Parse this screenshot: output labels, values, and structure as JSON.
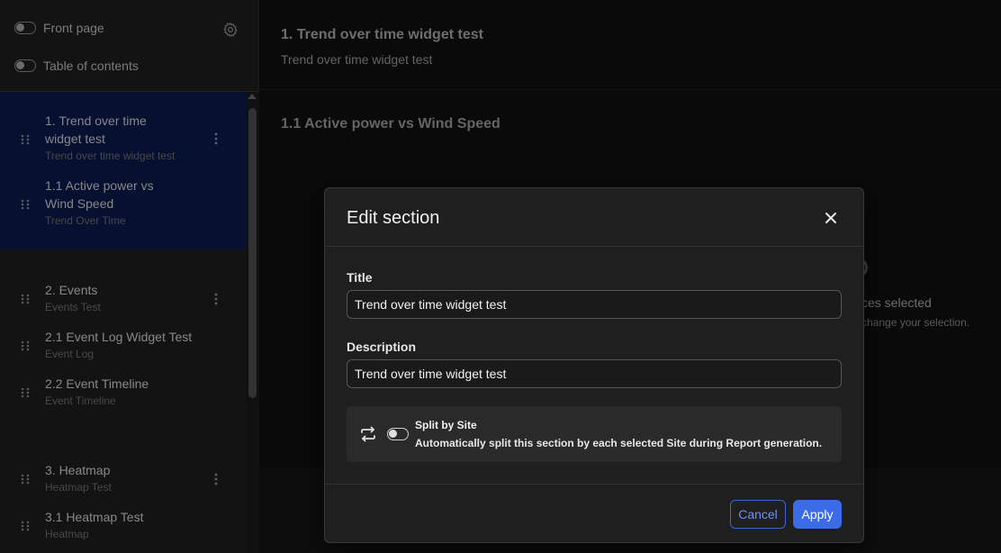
{
  "sidebar": {
    "toggles": [
      {
        "label": "Front page"
      },
      {
        "label": "Table of contents"
      }
    ],
    "items": [
      {
        "title_line1": "1. Trend over time",
        "title_line2": "widget test",
        "subtitle": "Trend over time widget test",
        "has_menu": true
      },
      {
        "title_line1": "1.1 Active power vs",
        "title_line2": "Wind Speed",
        "subtitle": "Trend Over Time",
        "has_menu": false
      },
      {
        "title_line1": "2. Events",
        "subtitle": "Events Test",
        "has_menu": true
      },
      {
        "title_line1": "2.1 Event Log Widget Test",
        "subtitle": "Event Log",
        "has_menu": false
      },
      {
        "title_line1": "2.2 Event Timeline",
        "subtitle": "Event Timeline",
        "has_menu": false
      },
      {
        "title_line1": "3. Heatmap",
        "subtitle": "Heatmap Test",
        "has_menu": true
      },
      {
        "title_line1": "3.1 Heatmap Test",
        "subtitle": "Heatmap",
        "has_menu": false
      }
    ]
  },
  "main": {
    "section_title": "1. Trend over time widget test",
    "section_description": "Trend over time widget test",
    "subsection_title": "1.1 Active power vs Wind Speed",
    "partial_text_1": "ces selected",
    "partial_text_2": "change your selection."
  },
  "modal": {
    "title": "Edit section",
    "title_label": "Title",
    "title_value": "Trend over time widget test",
    "description_label": "Description",
    "description_value": "Trend over time widget test",
    "split_title": "Split by Site",
    "split_description": "Automatically split this section by each selected Site during Report generation.",
    "cancel_label": "Cancel",
    "apply_label": "Apply"
  },
  "colors": {
    "accent": "#3b6be6",
    "selected_bg": "#0a1a4a"
  }
}
